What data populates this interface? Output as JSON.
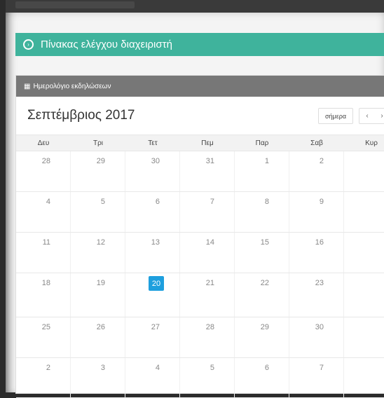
{
  "panel": {
    "title": "Πίνακας ελέγχου διαχειριστή"
  },
  "calendar": {
    "header": "Ημερολόγιο εκδηλώσεων",
    "month_title": "Σεπτέμβριος 2017",
    "today_label": "σήμερα",
    "prev_label": "‹",
    "next_label": "›",
    "weekdays": [
      "Δευ",
      "Τρι",
      "Τετ",
      "Πεμ",
      "Παρ",
      "Σαβ",
      "Κυρ"
    ],
    "today_date": "20",
    "weeks": [
      [
        "28",
        "29",
        "30",
        "31",
        "1",
        "2",
        ""
      ],
      [
        "4",
        "5",
        "6",
        "7",
        "8",
        "9",
        ""
      ],
      [
        "11",
        "12",
        "13",
        "14",
        "15",
        "16",
        ""
      ],
      [
        "18",
        "19",
        "20",
        "21",
        "22",
        "23",
        ""
      ],
      [
        "25",
        "26",
        "27",
        "28",
        "29",
        "30",
        ""
      ],
      [
        "2",
        "3",
        "4",
        "5",
        "6",
        "7",
        ""
      ]
    ]
  },
  "colors": {
    "accent": "#3fb39c",
    "header_gray": "#777777",
    "today": "#1e9fde"
  }
}
